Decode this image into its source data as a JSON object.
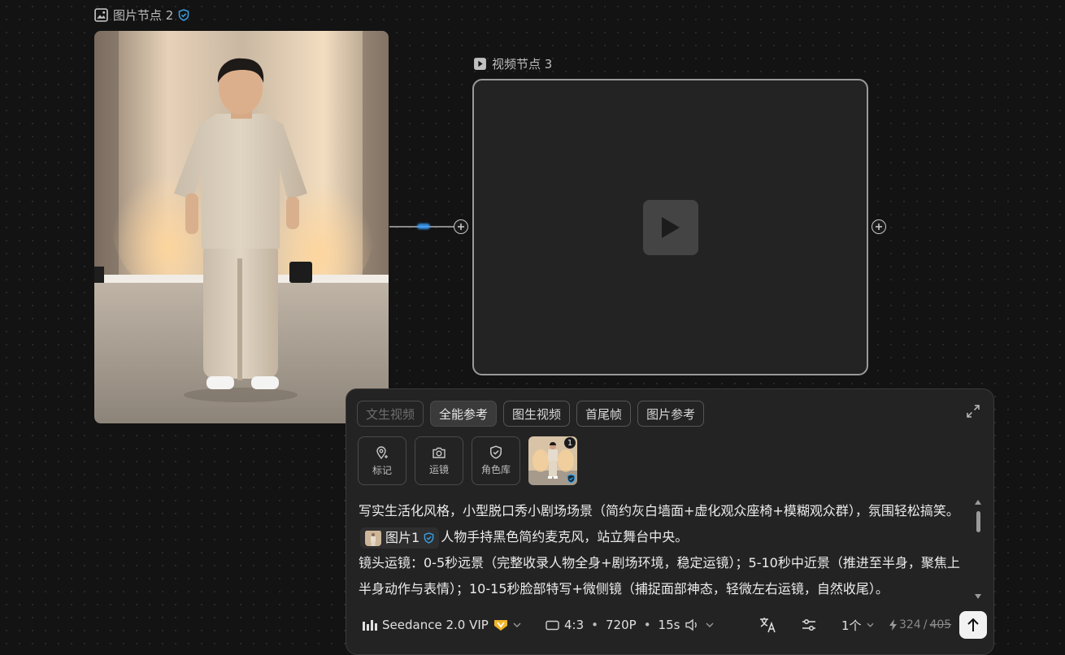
{
  "canvas": {
    "image_node": {
      "title": "图片节点 2"
    },
    "video_node": {
      "title": "视频节点 3"
    }
  },
  "panel": {
    "tabs": [
      {
        "label": "文生视频",
        "state": "disabled"
      },
      {
        "label": "全能参考",
        "state": "active"
      },
      {
        "label": "图生视频",
        "state": "normal"
      },
      {
        "label": "首尾帧",
        "state": "normal"
      },
      {
        "label": "图片参考",
        "state": "normal"
      }
    ],
    "tools": [
      {
        "label": "标记",
        "icon": "pin-icon"
      },
      {
        "label": "运镜",
        "icon": "camera-icon"
      },
      {
        "label": "角色库",
        "icon": "shield-check-icon"
      }
    ],
    "reference_thumb": {
      "badge": "1"
    },
    "prompt": {
      "p1_before_chip": "写实生活化风格，小型脱口秀小剧场场景（简约灰白墙面+虚化观众座椅+模糊观众群），氛围轻松搞笑。",
      "chip_label": "图片1",
      "p1_after_chip": "人物手持黑色简约麦克风，站立舞台中央。",
      "p2": "镜头运镜：0-5秒远景（完整收录人物全身+剧场环境，稳定运镜）；5-10秒中近景（推进至半身，聚焦上半身动作与表情）；10-15秒脸部特写+微侧镜（捕捉面部神态，轻微左右运镜，自然收尾）。"
    },
    "bottom_bar": {
      "model": "Seedance 2.0 VIP",
      "ratio": "4:3",
      "resolution": "720P",
      "duration": "15s",
      "count": "1个",
      "credits_used": "324",
      "credits_sep": "/",
      "credits_total": "405"
    }
  },
  "colors": {
    "accent_blue": "#3aa0ff",
    "vip_gold": "#f0b429"
  }
}
